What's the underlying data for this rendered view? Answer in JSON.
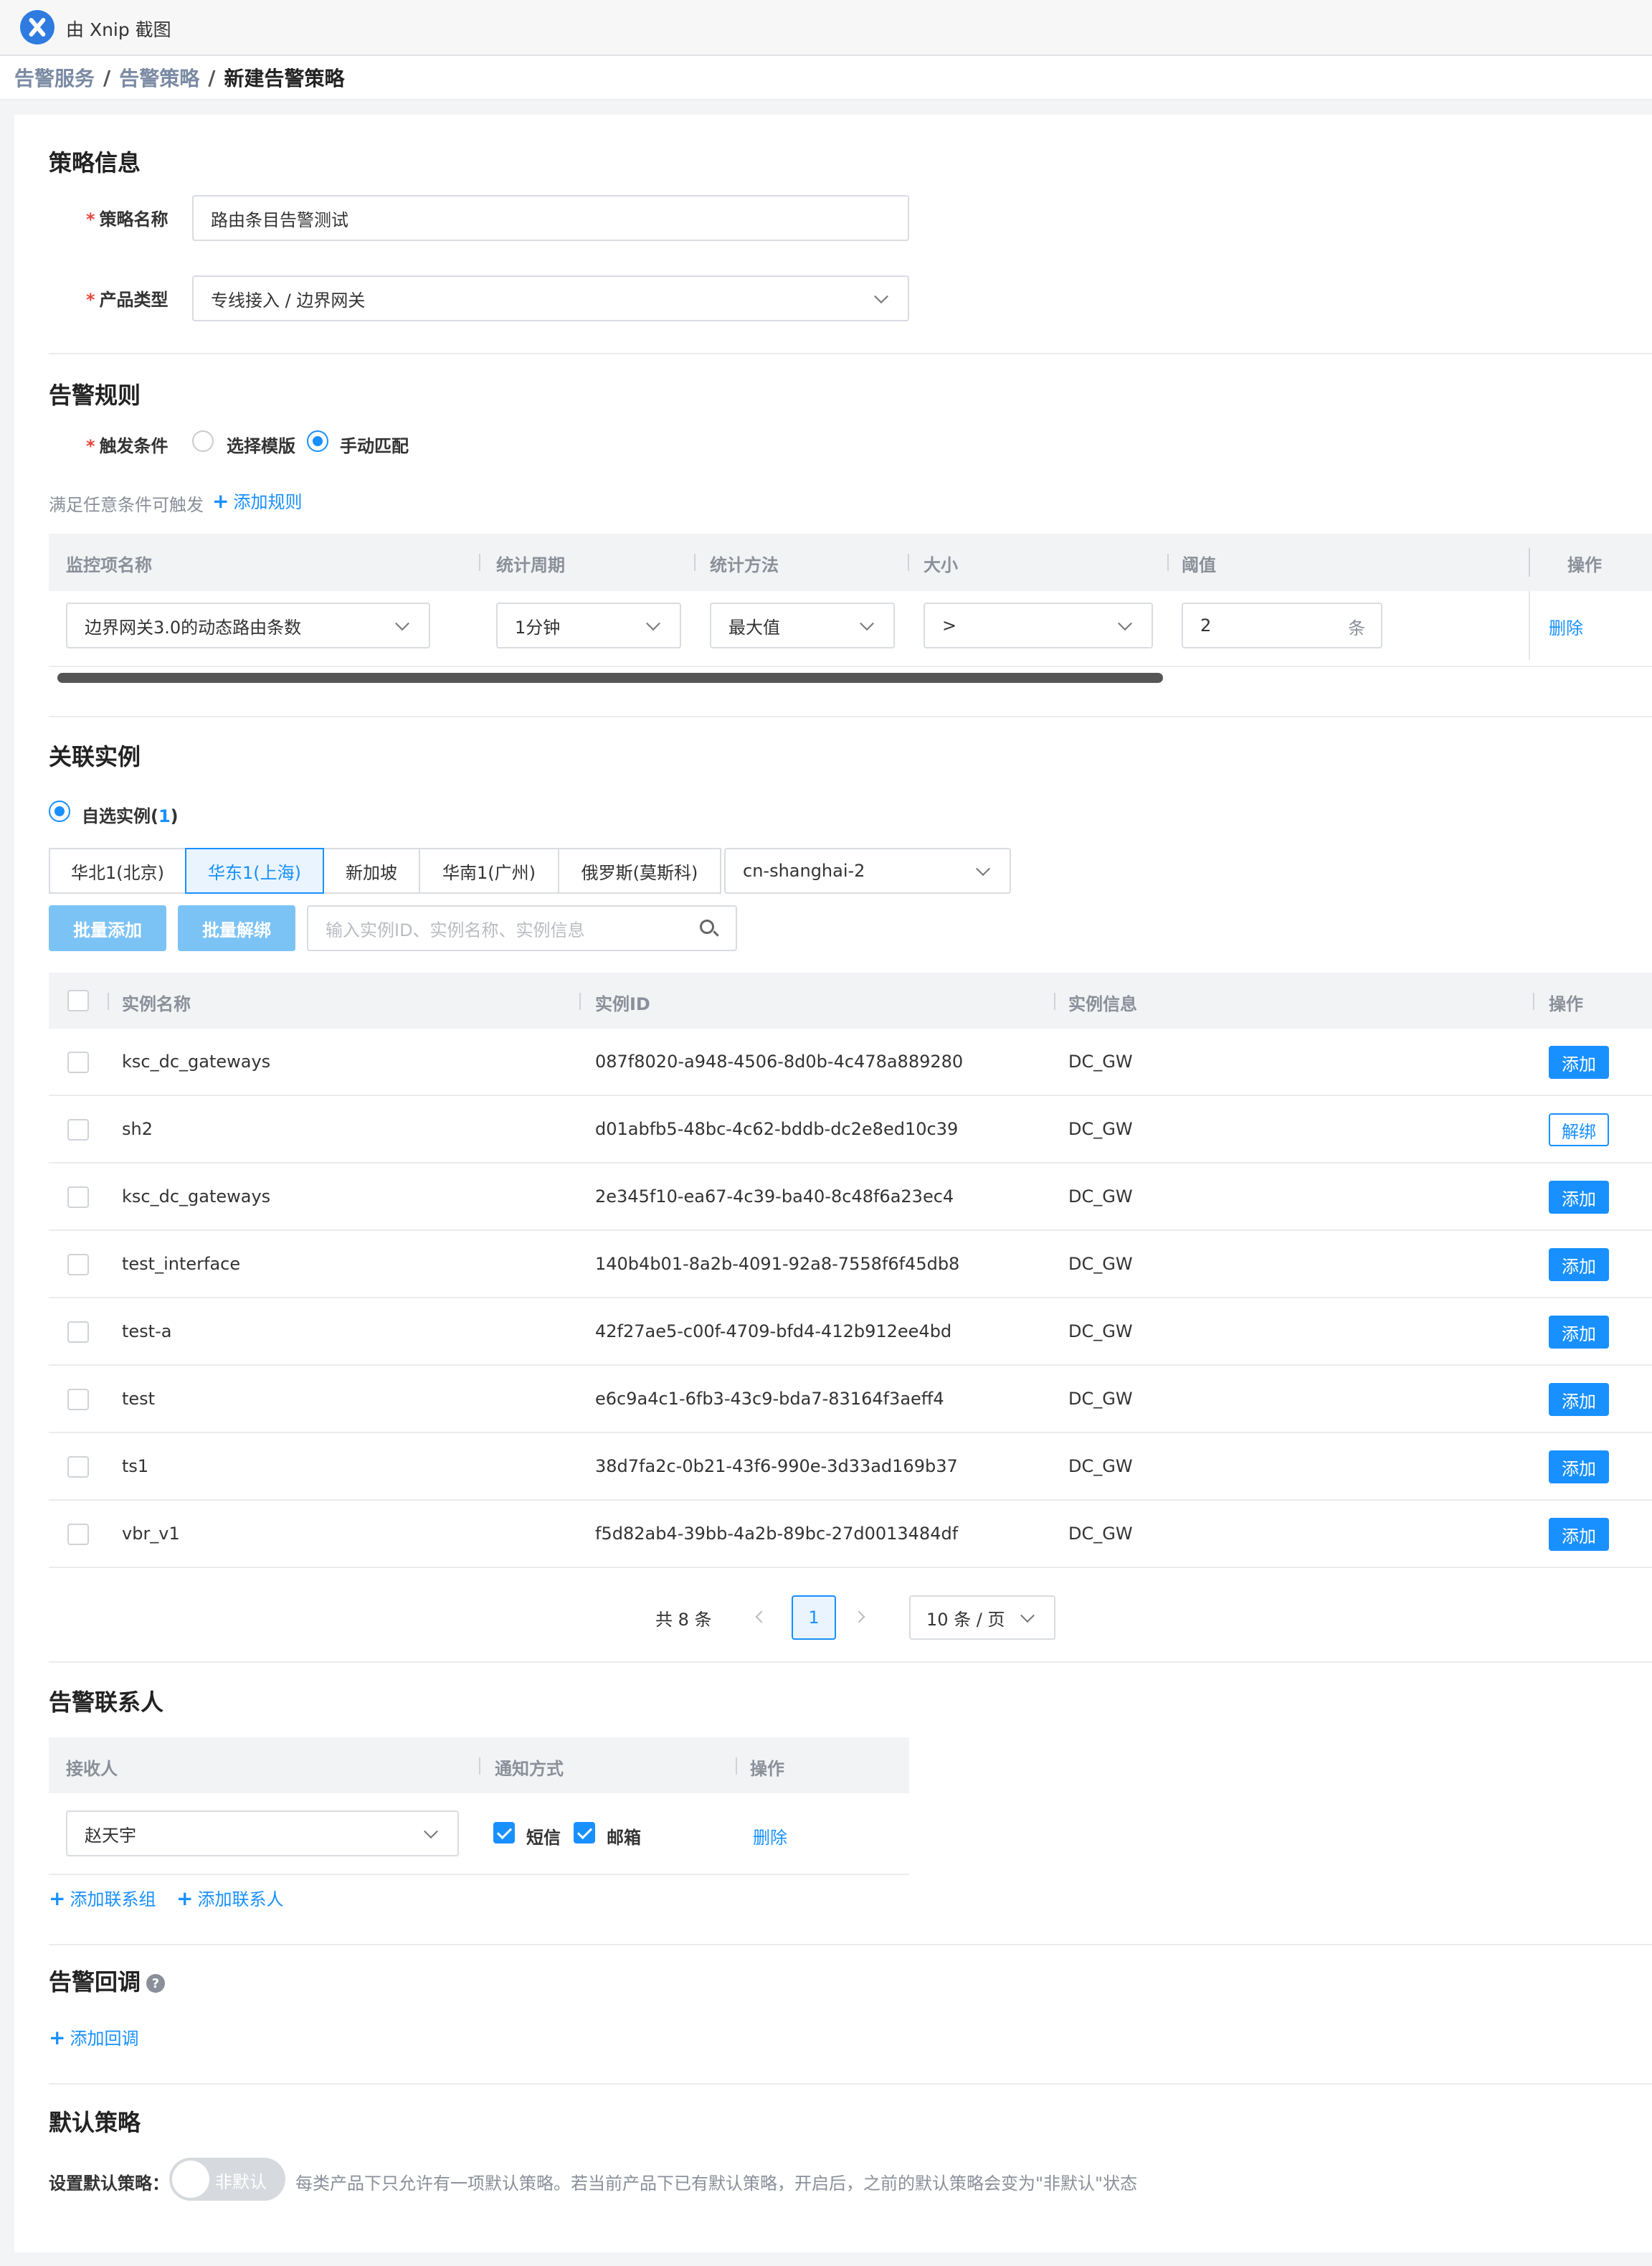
{
  "app": {
    "title": "由 Xnip 截图"
  },
  "breadcrumb": {
    "items": [
      "告警服务",
      "告警策略",
      "新建告警策略"
    ]
  },
  "policy": {
    "title": "策略信息",
    "name_label": "策略名称",
    "name_value": "路由条目告警测试",
    "type_label": "产品类型",
    "type_value": "专线接入 / 边界网关"
  },
  "rules": {
    "title": "告警规则",
    "trigger_label": "触发条件",
    "options": [
      "选择模版",
      "手动匹配"
    ],
    "selected_option": "手动匹配",
    "hint": "满足任意条件可触发",
    "add_rule": "添加规则",
    "columns": [
      "监控项名称",
      "统计周期",
      "统计方法",
      "大小",
      "阈值",
      "操作"
    ],
    "row": {
      "metric": "边界网关3.0的动态路由条数",
      "period": "1分钟",
      "method": "最大值",
      "operator": ">",
      "threshold": "2",
      "unit": "条",
      "action": "删除"
    }
  },
  "instances": {
    "title": "关联实例",
    "mode_label": "自选实例(",
    "mode_count": "1",
    "mode_close": ")",
    "regions": [
      "华北1(北京)",
      "华东1(上海)",
      "新加坡",
      "华南1(广州)",
      "俄罗斯(莫斯科)"
    ],
    "active_region": "华东1(上海)",
    "zone": "cn-shanghai-2",
    "batch_add": "批量添加",
    "batch_unbind": "批量解绑",
    "search_placeholder": "输入实例ID、实例名称、实例信息",
    "columns": [
      "实例名称",
      "实例ID",
      "实例信息",
      "操作"
    ],
    "rows": [
      {
        "name": "ksc_dc_gateways",
        "id": "087f8020-a948-4506-8d0b-4c478a889280",
        "info": "DC_GW",
        "action": "添加"
      },
      {
        "name": "sh2",
        "id": "d01abfb5-48bc-4c62-bddb-dc2e8ed10c39",
        "info": "DC_GW",
        "action": "解绑"
      },
      {
        "name": "ksc_dc_gateways",
        "id": "2e345f10-ea67-4c39-ba40-8c48f6a23ec4",
        "info": "DC_GW",
        "action": "添加"
      },
      {
        "name": "test_interface",
        "id": "140b4b01-8a2b-4091-92a8-7558f6f45db8",
        "info": "DC_GW",
        "action": "添加"
      },
      {
        "name": "test-a",
        "id": "42f27ae5-c00f-4709-bfd4-412b912ee4bd",
        "info": "DC_GW",
        "action": "添加"
      },
      {
        "name": "test",
        "id": "e6c9a4c1-6fb3-43c9-bda7-83164f3aeff4",
        "info": "DC_GW",
        "action": "添加"
      },
      {
        "name": "ts1",
        "id": "38d7fa2c-0b21-43f6-990e-3d33ad169b37",
        "info": "DC_GW",
        "action": "添加"
      },
      {
        "name": "vbr_v1",
        "id": "f5d82ab4-39bb-4a2b-89bc-27d0013484df",
        "info": "DC_GW",
        "action": "添加"
      }
    ],
    "pagination": {
      "total": "共 8 条",
      "page": "1",
      "page_size": "10 条 / 页"
    }
  },
  "contacts": {
    "title": "告警联系人",
    "columns": [
      "接收人",
      "通知方式",
      "操作"
    ],
    "row": {
      "receiver": "赵天宇",
      "sms": "短信",
      "email": "邮箱",
      "action": "删除"
    },
    "add_group": "添加联系组",
    "add_contact": "添加联系人"
  },
  "callback": {
    "title": "告警回调",
    "add": "添加回调"
  },
  "default_policy": {
    "title": "默认策略",
    "label": "设置默认策略：",
    "toggle_text": "非默认",
    "note": "每类产品下只允许有一项默认策略。若当前产品下已有默认策略，开启后，之前的默认策略会变为\"非默认\"状态"
  },
  "colors": {
    "primary": "#1890ff",
    "required": "#e8473b",
    "button_light": "#7cc3f5"
  }
}
